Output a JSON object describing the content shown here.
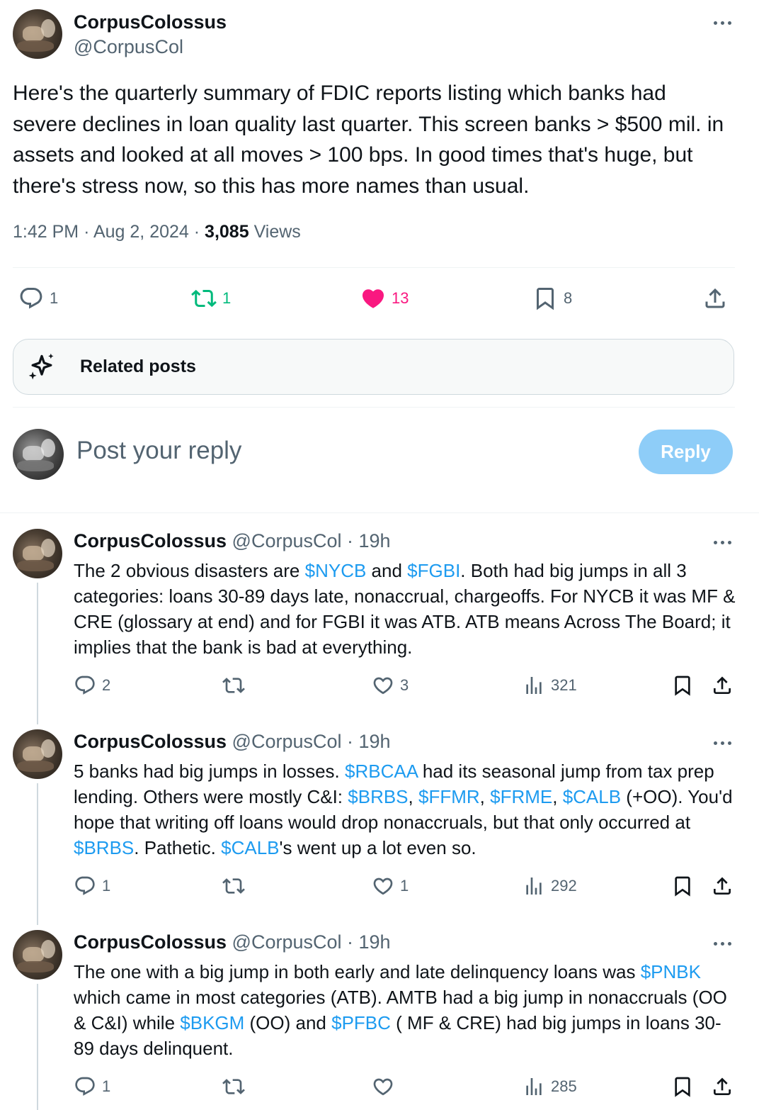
{
  "main_post": {
    "display_name": "CorpusColossus",
    "handle": "@CorpusCol",
    "text": "Here's the quarterly summary of FDIC reports listing which banks had severe declines in loan quality last quarter.  This screen banks > $500 mil. in assets and looked at all moves > 100 bps.  In good times that's huge, but there's stress now, so this has more names than usual.",
    "time": "1:42 PM",
    "date": "Aug 2, 2024",
    "views_count": "3,085",
    "views_label": "Views",
    "actions": {
      "replies": "1",
      "reposts": "1",
      "likes": "13",
      "bookmarks": "8"
    }
  },
  "related_posts": {
    "label": "Related posts"
  },
  "reply_composer": {
    "placeholder": "Post your reply",
    "button_label": "Reply"
  },
  "replies": [
    {
      "display_name": "CorpusColossus",
      "handle": "@CorpusCol",
      "time_ago": "19h",
      "segments": [
        {
          "t": "The 2 obvious disasters are "
        },
        {
          "t": "$NYCB",
          "tag": true
        },
        {
          "t": " and "
        },
        {
          "t": "$FGBI",
          "tag": true
        },
        {
          "t": ".  Both had big jumps in all 3 categories: loans 30-89 days late, nonaccrual, chargeoffs.  For NYCB it was MF & CRE (glossary at end) and for FGBI it was ATB.  ATB means Across The Board; it implies that the bank is bad at everything."
        }
      ],
      "replies": "2",
      "reposts": "",
      "likes": "3",
      "views": "321"
    },
    {
      "display_name": "CorpusColossus",
      "handle": "@CorpusCol",
      "time_ago": "19h",
      "segments": [
        {
          "t": "5 banks had big jumps in losses.  "
        },
        {
          "t": "$RBCAA",
          "tag": true
        },
        {
          "t": " had its seasonal jump from tax prep lending.  Others were mostly C&I:  "
        },
        {
          "t": "$BRBS",
          "tag": true
        },
        {
          "t": ", "
        },
        {
          "t": "$FFMR",
          "tag": true
        },
        {
          "t": ", "
        },
        {
          "t": "$FRME",
          "tag": true
        },
        {
          "t": ", "
        },
        {
          "t": "$CALB",
          "tag": true
        },
        {
          "t": " (+OO).  You'd hope that writing off loans would drop nonaccruals, but that only occurred at "
        },
        {
          "t": "$BRBS",
          "tag": true
        },
        {
          "t": ".  Pathetic.  "
        },
        {
          "t": "$CALB",
          "tag": true
        },
        {
          "t": "'s went up a lot even so."
        }
      ],
      "replies": "1",
      "reposts": "",
      "likes": "1",
      "views": "292"
    },
    {
      "display_name": "CorpusColossus",
      "handle": "@CorpusCol",
      "time_ago": "19h",
      "segments": [
        {
          "t": "The one with a big jump in both early and late delinquency loans was "
        },
        {
          "t": "$PNBK",
          "tag": true
        },
        {
          "t": " which came in most categories (ATB).  AMTB had a big jump in nonaccruals (OO & C&I) while "
        },
        {
          "t": "$BKGM",
          "tag": true
        },
        {
          "t": " (OO) and "
        },
        {
          "t": "$PFBC",
          "tag": true
        },
        {
          "t": " ( MF & CRE) had big jumps in loans 30-89 days delinquent."
        }
      ],
      "replies": "1",
      "reposts": "",
      "likes": "",
      "views": "285"
    }
  ],
  "colors": {
    "text": "#0f1419",
    "secondary": "#536471",
    "link": "#1d9bf0",
    "repost_active": "#00ba7c",
    "like_active": "#f91880",
    "reply_button": "#8ecdf8"
  },
  "icons": [
    "reply-icon",
    "repost-icon",
    "like-icon",
    "bookmark-icon",
    "share-icon",
    "views-icon",
    "sparkle-icon",
    "more-icon"
  ]
}
